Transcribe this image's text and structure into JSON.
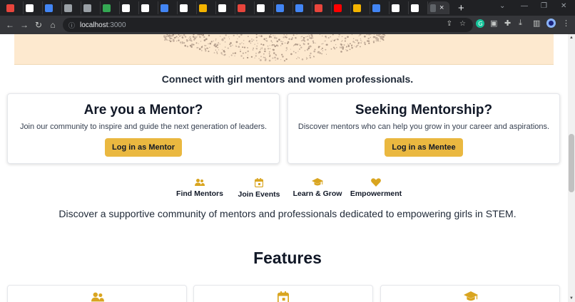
{
  "browser": {
    "tab_count_colors": [
      "#e8453c",
      "#ffffff",
      "#4285f4",
      "#9aa0a6",
      "#9aa0a6",
      "#34a853",
      "#ffffff",
      "#ffffff",
      "#4285f4",
      "#ffffff",
      "#f4b400",
      "#ffffff",
      "#e8453c",
      "#ffffff",
      "#4285f4",
      "#4285f4",
      "#e8453c",
      "#ff0000",
      "#f4b400",
      "#4285f4",
      "#ffffff",
      "#ffffff"
    ],
    "active_tab_close": "×",
    "new_tab": "+",
    "url_host": "localhost",
    "url_port": ":3000"
  },
  "page": {
    "subtitle": "Connect with girl mentors and women professionals.",
    "mentor_card": {
      "title": "Are you a Mentor?",
      "text": "Join our community to inspire and guide the next generation of leaders.",
      "button": "Log in as Mentor"
    },
    "mentee_card": {
      "title": "Seeking Mentorship?",
      "text": "Discover mentors who can help you grow in your career and aspirations.",
      "button": "Log in as Mentee"
    },
    "highlights": [
      {
        "label": "Find Mentors",
        "icon": "users-icon"
      },
      {
        "label": "Join Events",
        "icon": "calendar-icon"
      },
      {
        "label": "Learn & Grow",
        "icon": "graduation-cap-icon"
      },
      {
        "label": "Empowerment",
        "icon": "heart-icon"
      }
    ],
    "discover": "Discover a supportive community of mentors and professionals dedicated to empowering girls in STEM.",
    "features_title": "Features",
    "accent_color": "#eab840",
    "icon_color": "#d9a520"
  }
}
